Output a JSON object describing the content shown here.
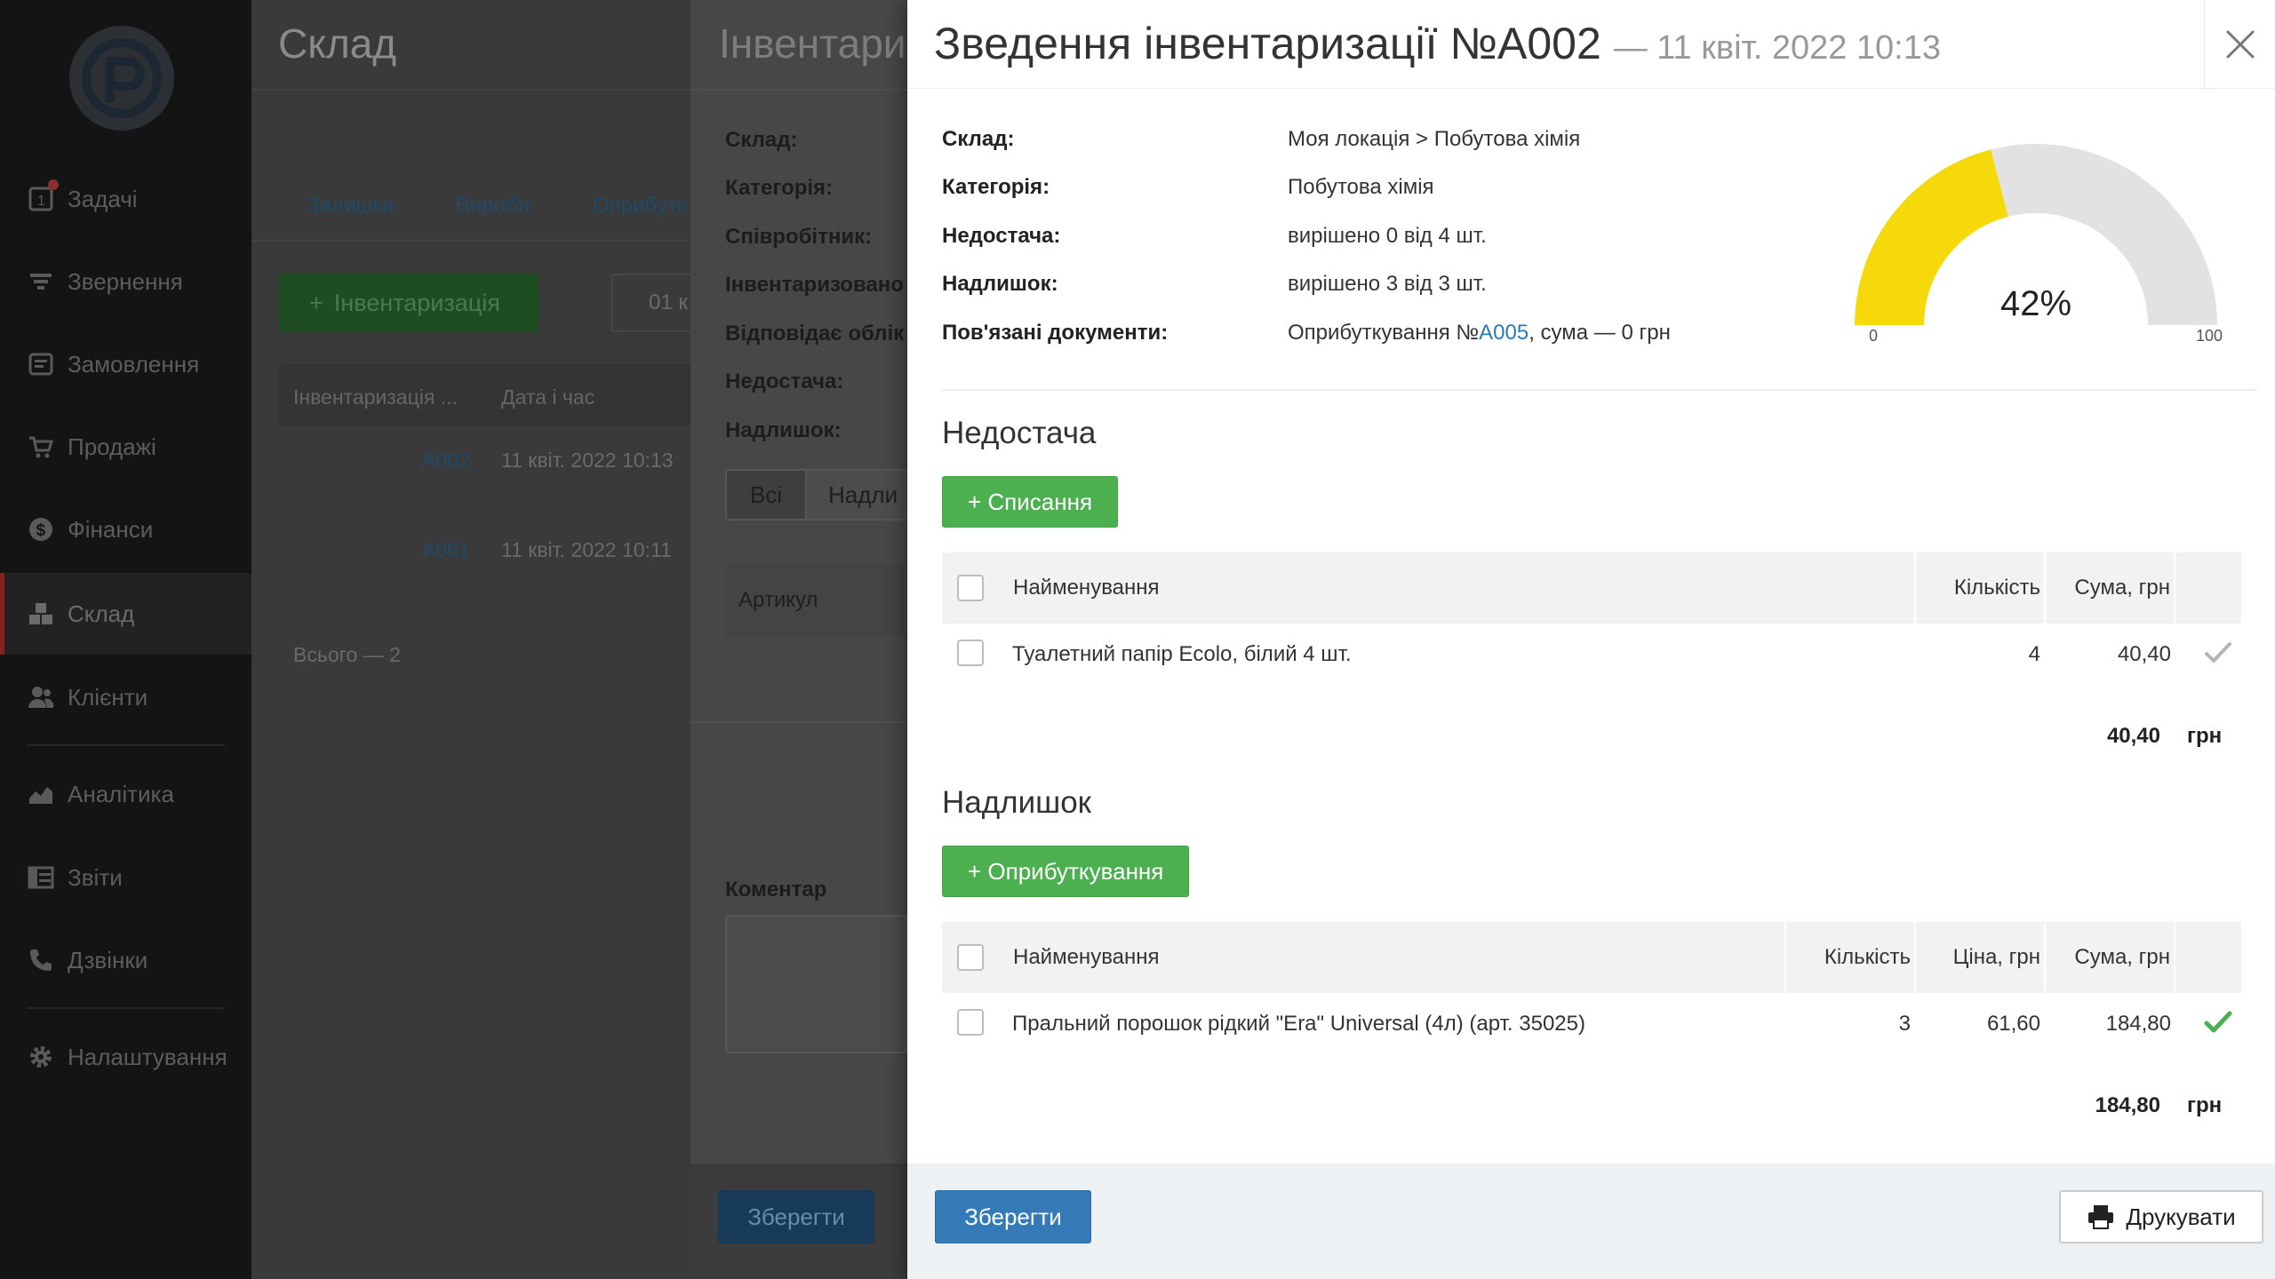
{
  "sidebar": {
    "items": [
      {
        "label": "Задачі",
        "icon": "task-icon"
      },
      {
        "label": "Звернення",
        "icon": "filter-icon"
      },
      {
        "label": "Замовлення",
        "icon": "order-icon"
      },
      {
        "label": "Продажі",
        "icon": "cart-icon"
      },
      {
        "label": "Фінанси",
        "icon": "dollar-icon"
      },
      {
        "label": "Склад",
        "icon": "boxes-icon",
        "active": true
      },
      {
        "label": "Клієнти",
        "icon": "users-icon"
      },
      {
        "label": "Аналітика",
        "icon": "chart-icon"
      },
      {
        "label": "Звіти",
        "icon": "report-icon"
      },
      {
        "label": "Дзвінки",
        "icon": "phone-icon"
      },
      {
        "label": "Налаштування",
        "icon": "gear-icon"
      }
    ]
  },
  "warehouse": {
    "title": "Склад",
    "tabs": [
      "Залишки",
      "Вироби",
      "Оприбутк"
    ],
    "add_button": "Інвентаризація",
    "date_box": "01 к",
    "columns": [
      "Інвентаризація ...",
      "Дата і час"
    ],
    "rows": [
      {
        "id": "A002",
        "date": "11 квіт. 2022 10:13"
      },
      {
        "id": "A001",
        "date": "11 квіт. 2022 10:11"
      }
    ],
    "total": "Всього — 2"
  },
  "inventory": {
    "title": "Інвентари",
    "labels": [
      "Склад:",
      "Категорія:",
      "Співробітник:",
      "Інвентаризовано",
      "Відповідає облік",
      "Недостача:",
      "Надлишок:"
    ],
    "filter_all": "Всі",
    "filter_surplus": "Надли",
    "articul": "Артикул",
    "comment_label": "Коментар",
    "save": "Зберегти"
  },
  "modal": {
    "title": "Зведення інвентаризації №A002",
    "subtitle": "— 11 квіт. 2022 10:13",
    "info": [
      {
        "label": "Склад:",
        "value": "Моя локація > Побутова хімія"
      },
      {
        "label": "Категорія:",
        "value": "Побутова хімія"
      },
      {
        "label": "Недостача:",
        "value": "вирішено 0 від 4 шт."
      },
      {
        "label": "Надлишок:",
        "value": "вирішено 3 від 3 шт."
      },
      {
        "label": "Пов'язані документи:",
        "value_prefix": "Оприбуткування №",
        "value_link": "A005",
        "value_suffix": ", сума — 0 грн"
      }
    ],
    "gauge": {
      "percent_text": "42%",
      "value": 0.42,
      "min": "0",
      "max": "100",
      "fill_color": "#f5d90a",
      "track_color": "#e2e2e2"
    },
    "shortage": {
      "title": "Недостача",
      "button": "+ Списання",
      "columns": [
        "Найменування",
        "Кількість",
        "Сума, грн"
      ],
      "rows": [
        {
          "name": "Туалетний папір Ecolo, білий 4 шт.",
          "qty": "4",
          "sum": "40,40",
          "resolved": false
        }
      ],
      "total": "40,40",
      "currency": "грн"
    },
    "surplus": {
      "title": "Надлишок",
      "button": "+ Оприбуткування",
      "columns": [
        "Найменування",
        "Кількість",
        "Ціна, грн",
        "Сума, грн"
      ],
      "rows": [
        {
          "name": "Пральний порошок рідкий \"Era\" Universal (4л) (арт. 35025)",
          "qty": "3",
          "price": "61,60",
          "sum": "184,80",
          "resolved": true
        }
      ],
      "total": "184,80",
      "currency": "грн"
    },
    "footer": {
      "save": "Зберегти",
      "print": "Друкувати"
    }
  },
  "colors": {
    "primary": "#337ab7",
    "success": "#4cb050",
    "link": "#2a7ab8",
    "gauge_fill": "#f5d90a",
    "check_resolved": "#4cb050",
    "check_unresolved": "#b5b5b5"
  }
}
